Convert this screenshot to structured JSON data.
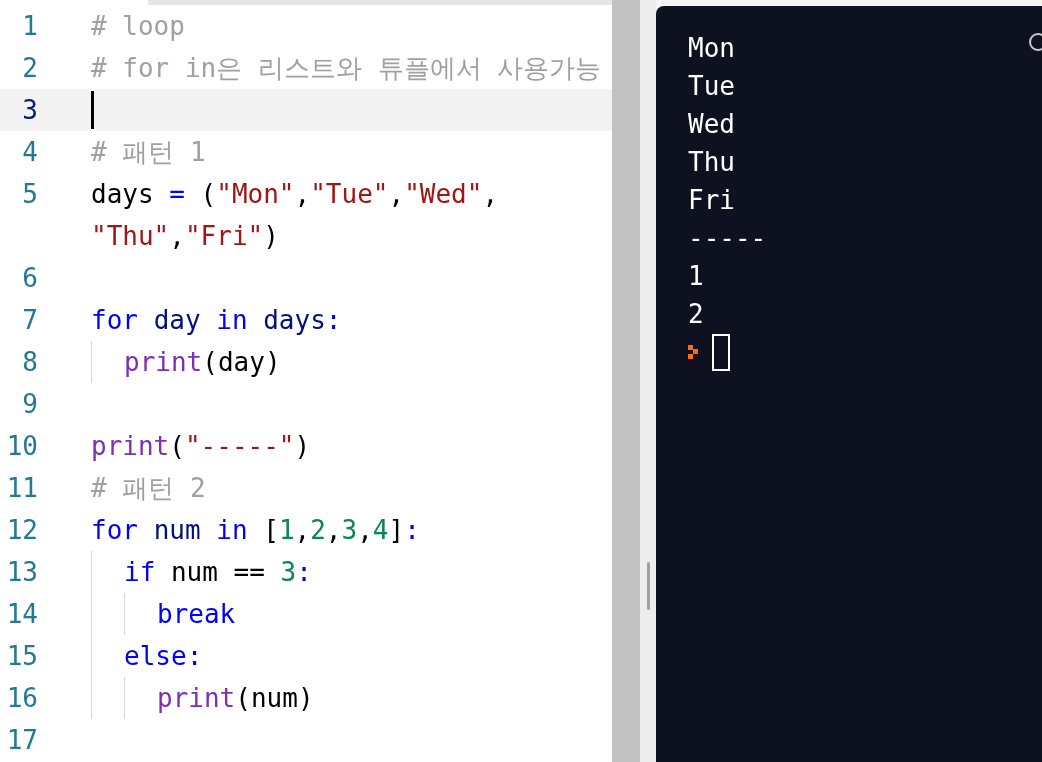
{
  "editor": {
    "lines": [
      {
        "number": "1",
        "current": false,
        "rows": [
          [
            {
              "kind": "comment",
              "text": "# loop"
            }
          ]
        ]
      },
      {
        "number": "2",
        "current": false,
        "rows": [
          [
            {
              "kind": "comment",
              "text": "# for in은 리스트와 튜플에서 사용가능"
            }
          ]
        ]
      },
      {
        "number": "3",
        "current": true
      },
      {
        "number": "4",
        "current": false,
        "rows": [
          [
            {
              "kind": "comment",
              "text": "# 패턴 1"
            }
          ]
        ]
      },
      {
        "number": "5",
        "current": false,
        "rows": [
          [
            {
              "kind": "plain",
              "text": "days "
            },
            {
              "kind": "operator",
              "text": "="
            },
            {
              "kind": "plain",
              "text": " ("
            },
            {
              "kind": "string",
              "text": "\"Mon\""
            },
            {
              "kind": "plain",
              "text": ","
            },
            {
              "kind": "string",
              "text": "\"Tue\""
            },
            {
              "kind": "plain",
              "text": ","
            },
            {
              "kind": "string",
              "text": "\"Wed\""
            },
            {
              "kind": "plain",
              "text": ","
            }
          ],
          [
            {
              "kind": "string",
              "text": "\"Thu\""
            },
            {
              "kind": "plain",
              "text": ","
            },
            {
              "kind": "string",
              "text": "\"Fri\""
            },
            {
              "kind": "plain",
              "text": ")"
            }
          ]
        ]
      },
      {
        "number": "6",
        "current": false
      },
      {
        "number": "7",
        "current": false,
        "rows": [
          [
            {
              "kind": "keyword",
              "text": "for"
            },
            {
              "kind": "plain",
              "text": " "
            },
            {
              "kind": "variable",
              "text": "day"
            },
            {
              "kind": "plain",
              "text": " "
            },
            {
              "kind": "keyword",
              "text": "in"
            },
            {
              "kind": "plain",
              "text": " "
            },
            {
              "kind": "variable",
              "text": "days"
            },
            {
              "kind": "operator",
              "text": ":"
            }
          ]
        ],
        "children": [
          {
            "number": "8",
            "current": false,
            "rows": [
              [
                {
                  "kind": "builtin",
                  "text": "print"
                },
                {
                  "kind": "plain",
                  "text": "(day)"
                }
              ]
            ]
          }
        ]
      },
      {
        "number": "9",
        "current": false
      },
      {
        "number": "10",
        "current": false,
        "rows": [
          [
            {
              "kind": "builtin",
              "text": "print"
            },
            {
              "kind": "plain",
              "text": "("
            },
            {
              "kind": "string",
              "text": "\"-----\""
            },
            {
              "kind": "plain",
              "text": ")"
            }
          ]
        ]
      },
      {
        "number": "11",
        "current": false,
        "rows": [
          [
            {
              "kind": "comment",
              "text": "# 패턴 2"
            }
          ]
        ]
      },
      {
        "number": "12",
        "current": false,
        "rows": [
          [
            {
              "kind": "keyword",
              "text": "for"
            },
            {
              "kind": "plain",
              "text": " "
            },
            {
              "kind": "variable",
              "text": "num"
            },
            {
              "kind": "plain",
              "text": " "
            },
            {
              "kind": "keyword",
              "text": "in"
            },
            {
              "kind": "plain",
              "text": " ["
            },
            {
              "kind": "number",
              "text": "1"
            },
            {
              "kind": "plain",
              "text": ","
            },
            {
              "kind": "number",
              "text": "2"
            },
            {
              "kind": "plain",
              "text": ","
            },
            {
              "kind": "number",
              "text": "3"
            },
            {
              "kind": "plain",
              "text": ","
            },
            {
              "kind": "number",
              "text": "4"
            },
            {
              "kind": "plain",
              "text": "]"
            },
            {
              "kind": "operator",
              "text": ":"
            }
          ]
        ],
        "children": [
          {
            "number": "13",
            "current": false,
            "rows": [
              [
                {
                  "kind": "keyword",
                  "text": "if"
                },
                {
                  "kind": "plain",
                  "text": " num == "
                },
                {
                  "kind": "number",
                  "text": "3"
                },
                {
                  "kind": "operator",
                  "text": ":"
                }
              ]
            ],
            "children": [
              {
                "number": "14",
                "current": false,
                "rows": [
                  [
                    {
                      "kind": "keyword",
                      "text": "break"
                    }
                  ]
                ]
              }
            ]
          },
          {
            "number": "15",
            "current": false,
            "rows": [
              [
                {
                  "kind": "keyword",
                  "text": "else"
                },
                {
                  "kind": "operator",
                  "text": ":"
                }
              ]
            ],
            "children": [
              {
                "number": "16",
                "current": false,
                "rows": [
                  [
                    {
                      "kind": "builtin",
                      "text": "print"
                    },
                    {
                      "kind": "plain",
                      "text": "(num)"
                    }
                  ]
                ]
              }
            ]
          }
        ]
      },
      {
        "number": "17",
        "current": false
      }
    ]
  },
  "terminal": {
    "output": [
      "Mon",
      "Tue",
      "Wed",
      "Thu",
      "Fri",
      "-----",
      "1",
      "2"
    ]
  }
}
